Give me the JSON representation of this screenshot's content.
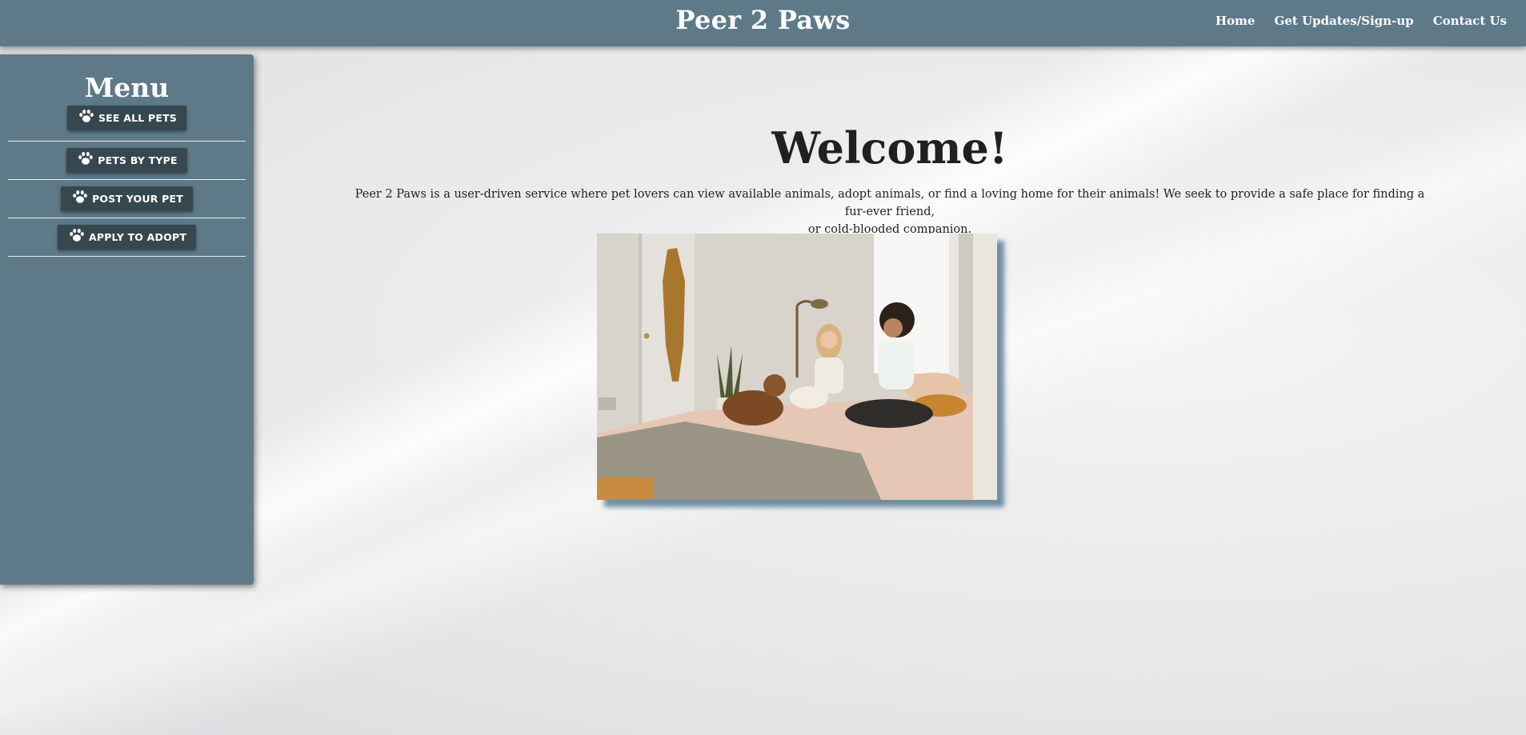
{
  "header": {
    "site_title": "Peer 2 Paws",
    "nav": [
      {
        "label": "Home"
      },
      {
        "label": "Get Updates/Sign-up"
      },
      {
        "label": "Contact Us"
      }
    ]
  },
  "sidebar": {
    "title": "Menu",
    "items": [
      {
        "label": "SEE ALL PETS",
        "icon": "paw-icon"
      },
      {
        "label": "PETS BY TYPE",
        "icon": "paw-icon"
      },
      {
        "label": "POST YOUR PET",
        "icon": "paw-icon"
      },
      {
        "label": "APPLY TO ADOPT",
        "icon": "paw-icon"
      }
    ]
  },
  "main": {
    "heading": "Welcome!",
    "intro_line1": "Peer 2 Paws is a user-driven service where pet lovers can view available animals, adopt animals, or find a loving home for their animals! We seek to provide a safe place for finding a fur-ever friend,",
    "intro_line2": "or cold-blooded companion."
  },
  "colors": {
    "accent": "#5e7a89",
    "button": "#37474f",
    "background": "#e9e9eb"
  }
}
